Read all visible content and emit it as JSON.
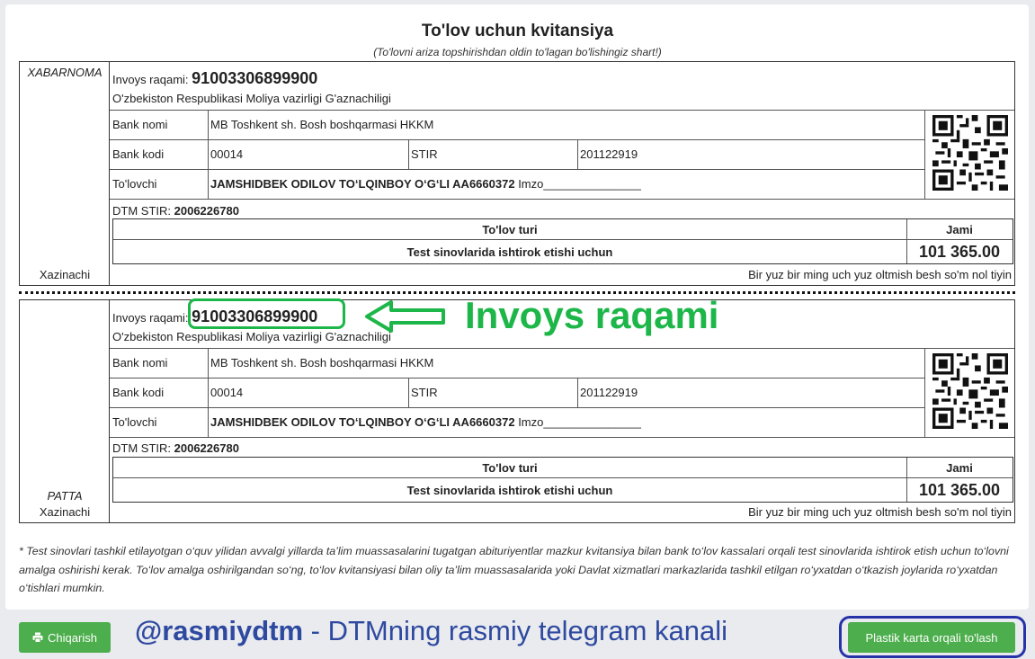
{
  "header": {
    "title": "To'lov uchun kvitansiya",
    "subtitle": "(To'lovni ariza topshirishdan oldin to'lagan bo'lishingiz shart!)"
  },
  "receipt_top": {
    "side_label": "XABARNOMA",
    "side_bottom": "Xazinachi",
    "invoice_label": "Invoys raqami:",
    "invoice_number": "91003306899900",
    "org": "O'zbekiston Respublikasi Moliya vazirligi G'aznachiligi",
    "bank_name_label": "Bank nomi",
    "bank_name": "MB Toshkent sh. Bosh boshqarmasi HKKM",
    "bank_code_label": "Bank kodi",
    "bank_code": "00014",
    "stir_label": "STIR",
    "stir": "201122919",
    "payer_label": "To'lovchi",
    "payer": "JAMSHIDBEK ODILOV TO‘LQINBOY O‘G‘LI AA6660372",
    "sign": "Imzo_______________",
    "dtm_stir_label": "DTM STIR:",
    "dtm_stir": "2006226780",
    "pay_type_header": "To'lov turi",
    "total_header": "Jami",
    "pay_type": "Test sinovlarida ishtirok etishi uchun",
    "total": "101 365.00",
    "amount_words": "Bir yuz bir ming uch yuz oltmish besh so'm nol tiyin"
  },
  "receipt_bottom": {
    "side_label": "PATTA",
    "side_bottom": "Xazinachi",
    "invoice_label": "Invoys raqami:",
    "invoice_number": "91003306899900",
    "org": "O'zbekiston Respublikasi Moliya vazirligi G'aznachiligi",
    "bank_name_label": "Bank nomi",
    "bank_name": "MB Toshkent sh. Bosh boshqarmasi HKKM",
    "bank_code_label": "Bank kodi",
    "bank_code": "00014",
    "stir_label": "STIR",
    "stir": "201122919",
    "payer_label": "To'lovchi",
    "payer": "JAMSHIDBEK ODILOV TO‘LQINBOY O‘G‘LI AA6660372",
    "sign": "Imzo_______________",
    "dtm_stir_label": "DTM STIR:",
    "dtm_stir": "2006226780",
    "pay_type_header": "To'lov turi",
    "total_header": "Jami",
    "pay_type": "Test sinovlarida ishtirok etishi uchun",
    "total": "101 365.00",
    "amount_words": "Bir yuz bir ming uch yuz oltmish besh so'm nol tiyin"
  },
  "annotation": {
    "label": "Invoys raqami",
    "color": "#1db648"
  },
  "note": "* Test sinovlari tashkil etilayotgan o‘quv yilidan avvalgi yillarda ta’lim muassasalarini tugatgan abituriyentlar mazkur kvitansiya bilan bank to‘lov kassalari orqali test sinovlarida ishtirok etish uchun to‘lovni amalga oshirishi kerak. To‘lov amalga oshirilgandan so‘ng, to‘lov kvitansiyasi bilan oliy ta’lim muassasalarida yoki Davlat xizmatlari markazlarida tashkil etilgan ro‘yxatdan o‘tkazish joylarida ro‘yxatdan o‘tishlari mumkin.",
  "footer": {
    "print_button": "Chiqarish",
    "print_icon": "print-icon",
    "telegram_handle": "@rasmiydtm",
    "telegram_text": " - DTMning rasmiy telegram kanali",
    "pay_button": "Plastik karta orqali to'lash",
    "button_color": "#4cae4c"
  }
}
